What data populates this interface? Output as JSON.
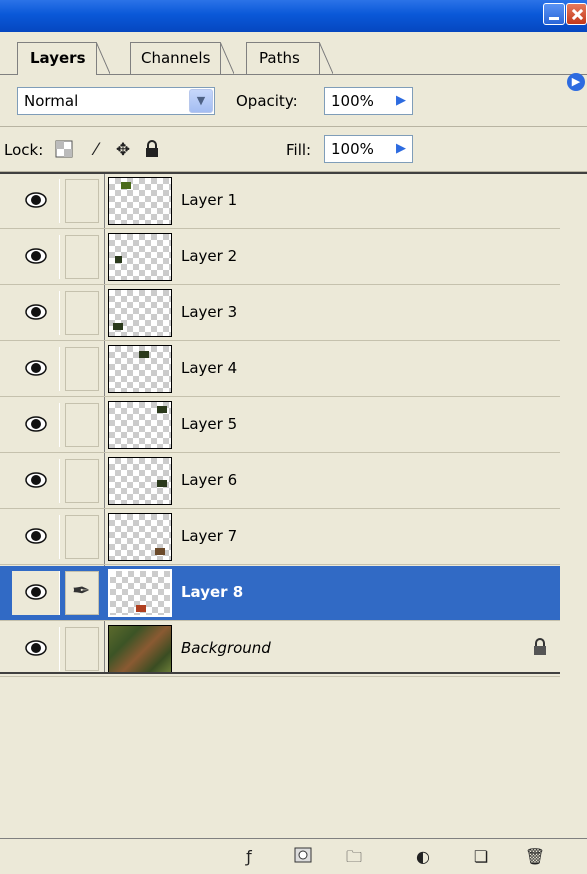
{
  "tabs": [
    {
      "label": "Layers"
    },
    {
      "label": "Channels"
    },
    {
      "label": "Paths"
    }
  ],
  "blend": {
    "mode": "Normal",
    "opacity_label": "Opacity:",
    "opacity_value": "100%"
  },
  "lock": {
    "label": "Lock:",
    "fill_label": "Fill:",
    "fill_value": "100%"
  },
  "layers": [
    {
      "name": "Layer 1",
      "visible": true,
      "selected": false
    },
    {
      "name": "Layer 2",
      "visible": true,
      "selected": false
    },
    {
      "name": "Layer 3",
      "visible": true,
      "selected": false
    },
    {
      "name": "Layer 4",
      "visible": true,
      "selected": false
    },
    {
      "name": "Layer 5",
      "visible": true,
      "selected": false
    },
    {
      "name": "Layer 6",
      "visible": true,
      "selected": false
    },
    {
      "name": "Layer 7",
      "visible": true,
      "selected": false
    },
    {
      "name": "Layer 8",
      "visible": true,
      "selected": true
    },
    {
      "name": "Background",
      "visible": true,
      "selected": false,
      "locked": true
    }
  ],
  "icons": {
    "eye": "eye-icon",
    "brush": "brush-icon",
    "lock": "padlock-icon"
  },
  "colors": {
    "panel": "#ece9d8",
    "selection": "#316ac5",
    "titlebar": "#0a58d8"
  }
}
